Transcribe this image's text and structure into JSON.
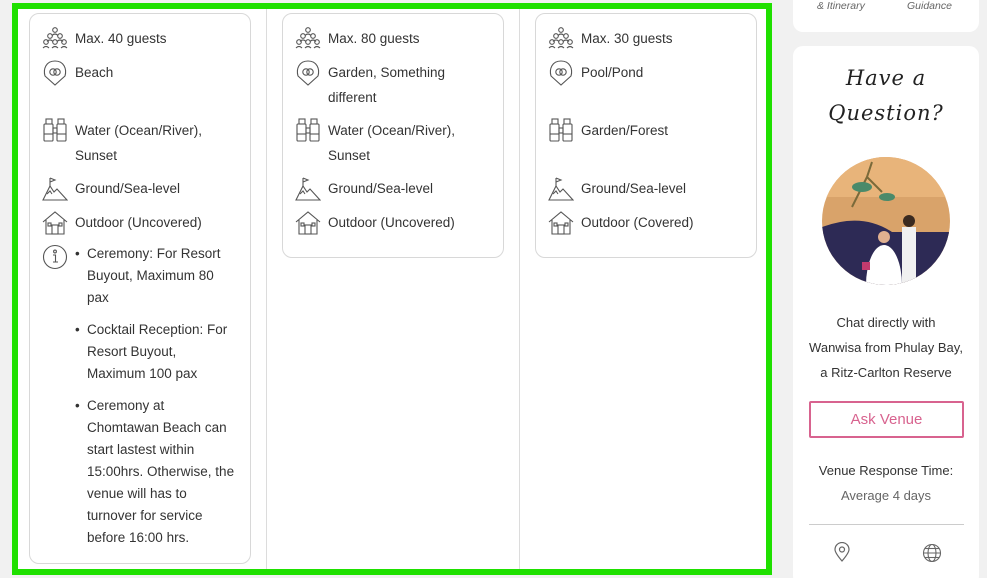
{
  "top_nav": {
    "left_label": "& Itinerary",
    "right_label": "Guidance"
  },
  "venues": [
    {
      "features": [
        {
          "icon": "guests-icon",
          "text": "Max. 40 guests"
        },
        {
          "icon": "rings-icon",
          "text": "Beach"
        },
        {
          "icon": "binoculars-icon",
          "text": "Water (Ocean/River),\nSunset"
        },
        {
          "icon": "mountain-icon",
          "text": "Ground/Sea-level"
        },
        {
          "icon": "house-icon",
          "text": "Outdoor (Uncovered)"
        }
      ],
      "notes": [
        "Ceremony: For Resort Buyout, Maximum 80 pax",
        "Cocktail Reception: For Resort Buyout, Maximum 100 pax",
        "Ceremony at Chomtawan Beach can start lastest within 15:00hrs. Otherwise, the venue will has to turnover for service before 16:00 hrs."
      ]
    },
    {
      "features": [
        {
          "icon": "guests-icon",
          "text": "Max. 80 guests"
        },
        {
          "icon": "rings-icon",
          "text": "Garden, Something\ndifferent"
        },
        {
          "icon": "binoculars-icon",
          "text": "Water (Ocean/River),\nSunset"
        },
        {
          "icon": "mountain-icon",
          "text": "Ground/Sea-level"
        },
        {
          "icon": "house-icon",
          "text": "Outdoor (Uncovered)"
        }
      ]
    },
    {
      "features": [
        {
          "icon": "guests-icon",
          "text": "Max. 30 guests"
        },
        {
          "icon": "rings-icon",
          "text": "Pool/Pond"
        },
        {
          "icon": "binoculars-icon",
          "text": "Garden/Forest"
        },
        {
          "icon": "mountain-icon",
          "text": "Ground/Sea-level"
        },
        {
          "icon": "house-icon",
          "text": "Outdoor (Covered)"
        }
      ]
    }
  ],
  "sidebar": {
    "heading_line1": "Have a",
    "heading_line2": "Question?",
    "chat_line1": "Chat directly with",
    "chat_line2": "Wanwisa from Phulay Bay,",
    "chat_line3": "a Ritz-Carlton Reserve",
    "ask_button": "Ask Venue",
    "response_label": "Venue Response Time:",
    "response_value": "Average 4 days",
    "accent_color": "#d8638f"
  },
  "highlight_color": "#1fe000"
}
